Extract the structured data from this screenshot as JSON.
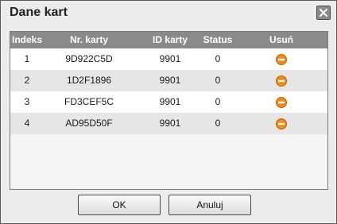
{
  "dialog": {
    "title": "Dane kart"
  },
  "table": {
    "columns": [
      "Indeks",
      "Nr. karty",
      "ID karty",
      "Status",
      "Usuń"
    ],
    "rows": [
      {
        "index": "1",
        "card_no": "9D922C5D",
        "card_id": "9901",
        "status": "0",
        "remove_icon": "remove-circle-icon"
      },
      {
        "index": "2",
        "card_no": "1D2F1896",
        "card_id": "9901",
        "status": "0",
        "remove_icon": "remove-circle-icon"
      },
      {
        "index": "3",
        "card_no": "FD3CEF5C",
        "card_id": "9901",
        "status": "0",
        "remove_icon": "remove-circle-icon"
      },
      {
        "index": "4",
        "card_no": "AD95D50F",
        "card_id": "9901",
        "status": "0",
        "remove_icon": "remove-circle-icon"
      }
    ]
  },
  "buttons": {
    "ok_label": "OK",
    "cancel_label": "Anuluj"
  },
  "colors": {
    "header_bg": "#8a8a8a",
    "remove_icon": "#f08a1c"
  }
}
